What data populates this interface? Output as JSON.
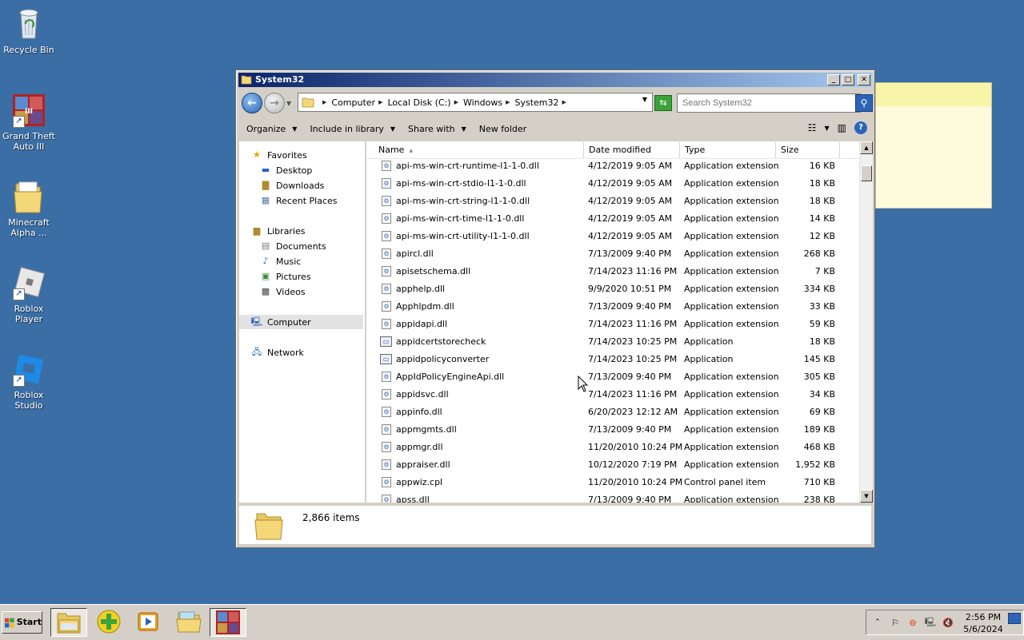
{
  "desktop": {
    "icons": [
      {
        "label": "Recycle Bin",
        "icon": "recycle-bin-icon"
      },
      {
        "label": "Grand Theft Auto III",
        "icon": "gta3-icon"
      },
      {
        "label": "Minecraft Alpha ...",
        "icon": "folder-icon"
      },
      {
        "label": "Roblox Player",
        "icon": "roblox-player-icon"
      },
      {
        "label": "Roblox Studio",
        "icon": "roblox-studio-icon"
      }
    ]
  },
  "window": {
    "title": "System32",
    "controls": {
      "minimize": "_",
      "maximize": "□",
      "close": "✕"
    },
    "breadcrumb": [
      "Computer",
      "Local Disk (C:)",
      "Windows",
      "System32"
    ],
    "search_placeholder": "Search System32",
    "toolbar": {
      "organize": "Organize",
      "include_in_library": "Include in library",
      "share_with": "Share with",
      "new_folder": "New folder"
    },
    "nav": {
      "favorites": "Favorites",
      "desktop": "Desktop",
      "downloads": "Downloads",
      "recent_places": "Recent Places",
      "libraries": "Libraries",
      "documents": "Documents",
      "music": "Music",
      "pictures": "Pictures",
      "videos": "Videos",
      "computer": "Computer",
      "network": "Network"
    },
    "columns": {
      "name": "Name",
      "date_modified": "Date modified",
      "type": "Type",
      "size": "Size"
    },
    "files": [
      {
        "name": "api-ms-win-crt-runtime-l1-1-0.dll",
        "date": "4/12/2019 9:05 AM",
        "type": "Application extension",
        "size": "16 KB",
        "kind": "dll"
      },
      {
        "name": "api-ms-win-crt-stdio-l1-1-0.dll",
        "date": "4/12/2019 9:05 AM",
        "type": "Application extension",
        "size": "18 KB",
        "kind": "dll"
      },
      {
        "name": "api-ms-win-crt-string-l1-1-0.dll",
        "date": "4/12/2019 9:05 AM",
        "type": "Application extension",
        "size": "18 KB",
        "kind": "dll"
      },
      {
        "name": "api-ms-win-crt-time-l1-1-0.dll",
        "date": "4/12/2019 9:05 AM",
        "type": "Application extension",
        "size": "14 KB",
        "kind": "dll"
      },
      {
        "name": "api-ms-win-crt-utility-l1-1-0.dll",
        "date": "4/12/2019 9:05 AM",
        "type": "Application extension",
        "size": "12 KB",
        "kind": "dll"
      },
      {
        "name": "apircl.dll",
        "date": "7/13/2009 9:40 PM",
        "type": "Application extension",
        "size": "268 KB",
        "kind": "dll"
      },
      {
        "name": "apisetschema.dll",
        "date": "7/14/2023 11:16 PM",
        "type": "Application extension",
        "size": "7 KB",
        "kind": "dll"
      },
      {
        "name": "apphelp.dll",
        "date": "9/9/2020 10:51 PM",
        "type": "Application extension",
        "size": "334 KB",
        "kind": "dll"
      },
      {
        "name": "Apphlpdm.dll",
        "date": "7/13/2009 9:40 PM",
        "type": "Application extension",
        "size": "33 KB",
        "kind": "dll"
      },
      {
        "name": "appidapi.dll",
        "date": "7/14/2023 11:16 PM",
        "type": "Application extension",
        "size": "59 KB",
        "kind": "dll"
      },
      {
        "name": "appidcertstorecheck",
        "date": "7/14/2023 10:25 PM",
        "type": "Application",
        "size": "18 KB",
        "kind": "exe"
      },
      {
        "name": "appidpolicyconverter",
        "date": "7/14/2023 10:25 PM",
        "type": "Application",
        "size": "145 KB",
        "kind": "exe"
      },
      {
        "name": "AppIdPolicyEngineApi.dll",
        "date": "7/13/2009 9:40 PM",
        "type": "Application extension",
        "size": "305 KB",
        "kind": "dll"
      },
      {
        "name": "appidsvc.dll",
        "date": "7/14/2023 11:16 PM",
        "type": "Application extension",
        "size": "34 KB",
        "kind": "dll"
      },
      {
        "name": "appinfo.dll",
        "date": "6/20/2023 12:12 AM",
        "type": "Application extension",
        "size": "69 KB",
        "kind": "dll"
      },
      {
        "name": "appmgmts.dll",
        "date": "7/13/2009 9:40 PM",
        "type": "Application extension",
        "size": "189 KB",
        "kind": "dll"
      },
      {
        "name": "appmgr.dll",
        "date": "11/20/2010 10:24 PM",
        "type": "Application extension",
        "size": "468 KB",
        "kind": "dll"
      },
      {
        "name": "appraiser.dll",
        "date": "10/12/2020 7:19 PM",
        "type": "Application extension",
        "size": "1,952 KB",
        "kind": "dll"
      },
      {
        "name": "appwiz.cpl",
        "date": "11/20/2010 10:24 PM",
        "type": "Control panel item",
        "size": "710 KB",
        "kind": "dll"
      },
      {
        "name": "apss.dll",
        "date": "7/13/2009 9:40 PM",
        "type": "Application extension",
        "size": "238 KB",
        "kind": "dll"
      }
    ],
    "status": {
      "item_count": "2,866 items"
    }
  },
  "taskbar": {
    "start_label": "Start",
    "apps": [
      "explorer-icon",
      "green-plus-icon",
      "media-player-icon",
      "folder-icon",
      "gta3-icon"
    ],
    "clock": {
      "time": "2:56 PM",
      "date": "5/6/2024"
    }
  },
  "colors": {
    "desktop": "#3a6ea5",
    "titlebar": "#0a246a",
    "chrome": "#d4d0c8",
    "sticky": "#fdfbdb"
  }
}
